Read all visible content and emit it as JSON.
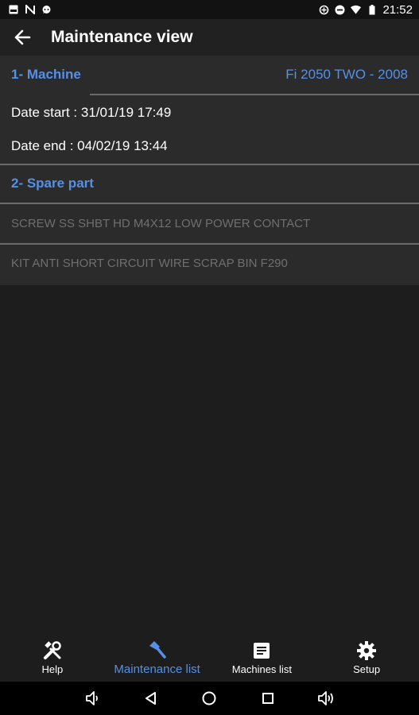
{
  "status_bar": {
    "time": "21:52",
    "left_icons": [
      "image-icon",
      "n-icon",
      "chat-icon"
    ],
    "right_icons": [
      "data-saver-icon",
      "dnd-icon",
      "wifi-icon",
      "battery-icon"
    ]
  },
  "app_bar": {
    "title": "Maintenance view",
    "back_icon": "arrow-left-icon"
  },
  "machine": {
    "label": "1- Machine",
    "value": "Fi 2050 TWO - 2008",
    "date_start": "Date start : 31/01/19 17:49",
    "date_end": "Date end : 04/02/19 13:44"
  },
  "spare_part": {
    "label": "2- Spare part",
    "items": [
      "SCREW SS SHBT HD M4X12 LOW POWER CONTACT",
      "KIT ANTI SHORT CIRCUIT WIRE SCRAP BIN F290"
    ]
  },
  "bottom_nav": {
    "items": [
      {
        "label": "Help",
        "icon": "tools-icon",
        "active": false
      },
      {
        "label": "Maintenance list",
        "icon": "hammer-icon",
        "active": true
      },
      {
        "label": "Machines list",
        "icon": "list-document-icon",
        "active": false
      },
      {
        "label": "Setup",
        "icon": "gear-icon",
        "active": false
      }
    ]
  },
  "system_nav": [
    "volume-down-icon",
    "back-triangle-icon",
    "home-circle-icon",
    "recents-square-icon",
    "volume-up-icon"
  ],
  "colors": {
    "accent": "#5590e6",
    "background": "#1d1d1d",
    "card": "#2b2b2b",
    "muted_text": "#6f6f6f"
  }
}
